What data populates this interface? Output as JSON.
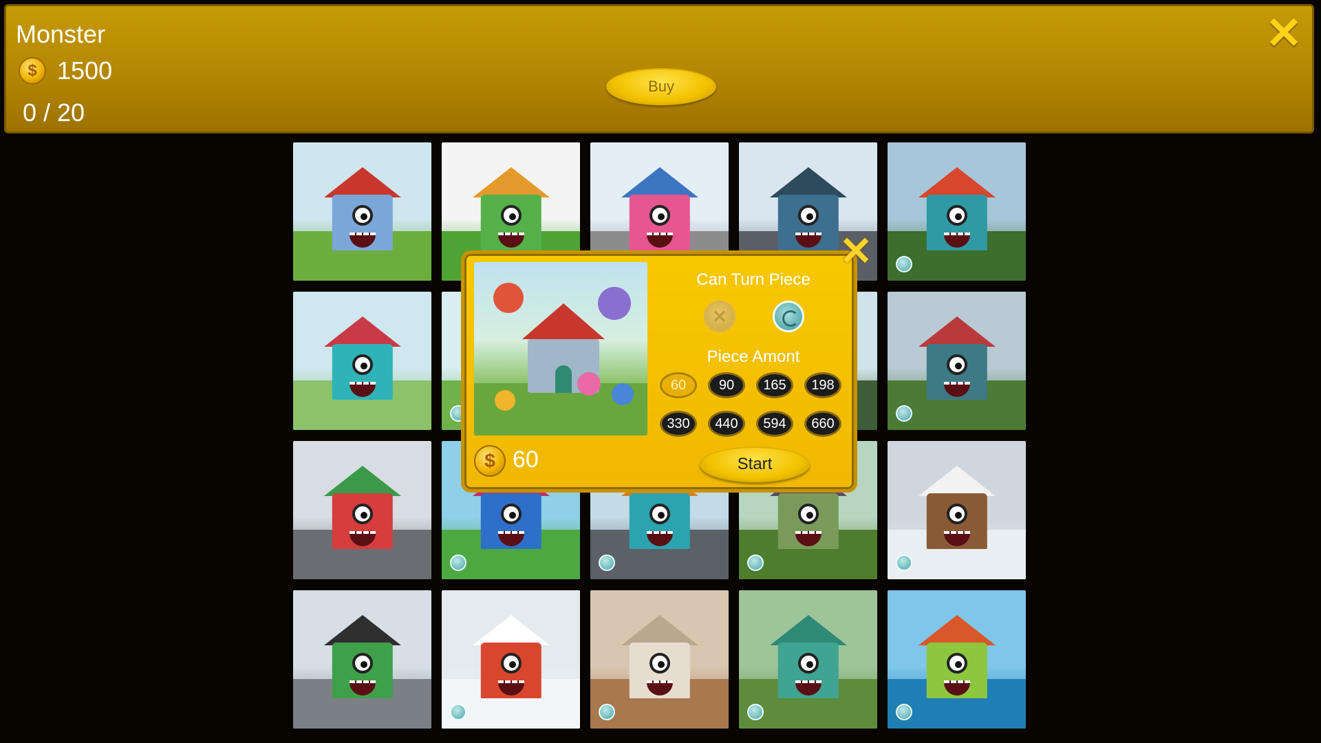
{
  "header": {
    "title": "Monster",
    "coins": "1500",
    "progress": "0 / 20",
    "buy_label": "Buy",
    "close_icon": "close-icon"
  },
  "colors": {
    "header_gold": "#b28402",
    "modal_gold": "#f5c000",
    "close_yellow": "#ffd21a",
    "background": "#080400"
  },
  "puzzles": [
    {
      "sky": "#cfe6ef",
      "ground": "#6cae3e",
      "house": "#7ba6d8",
      "roof": "#c8372d",
      "turn": false
    },
    {
      "sky": "#f4f4f4",
      "ground": "#4fa335",
      "house": "#55b04a",
      "roof": "#e39a2b",
      "turn": false
    },
    {
      "sky": "#e4eef5",
      "ground": "#8c8c8c",
      "house": "#e7568f",
      "roof": "#3c76c2",
      "turn": false
    },
    {
      "sky": "#d9e6ef",
      "ground": "#5a5f66",
      "house": "#3d6f8f",
      "roof": "#2e4a5d",
      "turn": false
    },
    {
      "sky": "#a8c6d9",
      "ground": "#3c6e2c",
      "house": "#2f9aa4",
      "roof": "#d9462e",
      "turn": true
    },
    {
      "sky": "#cfe7ef",
      "ground": "#8bc26a",
      "house": "#2eb3b8",
      "roof": "#c83a45",
      "turn": false
    },
    {
      "sky": "#d8eef1",
      "ground": "#6fb24a",
      "house": "#4a9ed0",
      "roof": "#e26a2c",
      "turn": true
    },
    {
      "sky": "#c6e0ea",
      "ground": "#5e8f3a",
      "house": "#e0a63a",
      "roof": "#3a5f8a",
      "turn": false
    },
    {
      "sky": "#cfe3ea",
      "ground": "#3f5d36",
      "house": "#9e6bb0",
      "roof": "#2b2b2b",
      "turn": false
    },
    {
      "sky": "#b9cad4",
      "ground": "#4d7a34",
      "house": "#3d7a86",
      "roof": "#b83a3a",
      "turn": true
    },
    {
      "sky": "#d7dde2",
      "ground": "#6a6e72",
      "house": "#d63d3d",
      "roof": "#3a9a4a",
      "turn": false
    },
    {
      "sky": "#8fd0e8",
      "ground": "#4ea842",
      "house": "#2e6fc9",
      "roof": "#c02f6a",
      "turn": true
    },
    {
      "sky": "#c3dbe6",
      "ground": "#5b6166",
      "house": "#2aa4b0",
      "roof": "#d67f1e",
      "turn": true
    },
    {
      "sky": "#b7d6c0",
      "ground": "#4f7d2e",
      "house": "#7a9a5a",
      "roof": "#5a4a6a",
      "turn": true
    },
    {
      "sky": "#cfd6dd",
      "ground": "#e8eef2",
      "house": "#8a5a36",
      "roof": "#f2f2f2",
      "turn": true
    },
    {
      "sky": "#d6dfe6",
      "ground": "#7b8087",
      "house": "#3fa04a",
      "roof": "#2f2f2f",
      "turn": false
    },
    {
      "sky": "#e4eaee",
      "ground": "#f2f6f8",
      "house": "#d9462e",
      "roof": "#ffffff",
      "turn": true
    },
    {
      "sky": "#d9c6b0",
      "ground": "#a9784e",
      "house": "#e6ddd0",
      "roof": "#b9a88f",
      "turn": true
    },
    {
      "sky": "#9fc49a",
      "ground": "#5e8c3c",
      "house": "#3fa492",
      "roof": "#2e8a76",
      "turn": true
    },
    {
      "sky": "#7fc6ea",
      "ground": "#1f7fb5",
      "house": "#8dc63f",
      "roof": "#d9572a",
      "turn": true
    }
  ],
  "modal": {
    "close_icon": "close-icon",
    "turn_label": "Can Turn Piece",
    "amount_label": "Piece Amont",
    "no_turn_icon": "x-icon",
    "turn_icon": "rotate-icon",
    "piece_options": [
      "60",
      "90",
      "165",
      "198",
      "330",
      "440",
      "594",
      "660"
    ],
    "selected_piece": "60",
    "cost": "60",
    "start_label": "Start"
  }
}
